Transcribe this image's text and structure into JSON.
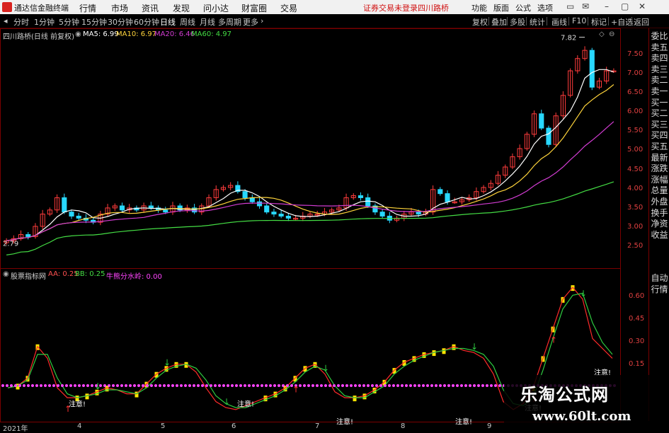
{
  "app": {
    "title": "通达信金融终端"
  },
  "menu": [
    "行情",
    "市场",
    "资讯",
    "发现",
    "问小达",
    "财富圈",
    "交易"
  ],
  "notice": "证券交易未登录",
  "stock_name_top": "四川路桥",
  "top_right": [
    "功能",
    "版面",
    "公式",
    "选项"
  ],
  "toolbar": {
    "periods": [
      "分时",
      "1分钟",
      "5分钟",
      "15分钟",
      "30分钟",
      "60分钟",
      "日线",
      "周线",
      "月线",
      "多周期",
      "更多"
    ],
    "active_period": "日线",
    "right": [
      "复权",
      "叠加",
      "多股",
      "统计",
      "画线",
      "F10",
      "标记",
      "+自选",
      "返回"
    ]
  },
  "main_info": {
    "title": "四川路桥(日线 前复权)",
    "ma5": "MA5: 6.99",
    "ma10": "MA10: 6.97",
    "ma20": "MA20: 6.46",
    "ma60": "MA60: 4.97",
    "high_label": "7.82",
    "low_label": "2.79"
  },
  "sub_info": {
    "title": "股票指标网",
    "aa": "AA: 0.25",
    "bb": "BB: 0.25",
    "cc": "牛熊分水岭: 0.00"
  },
  "main_axis": [
    "7.50",
    "7.00",
    "6.50",
    "6.00",
    "5.50",
    "5.00",
    "4.50",
    "4.00",
    "3.50",
    "3.00",
    "2.50"
  ],
  "sub_axis": [
    "0.60",
    "0.45",
    "0.30",
    "0.15"
  ],
  "x_axis": [
    "2021年",
    "4",
    "5",
    "6",
    "7",
    "8",
    "9"
  ],
  "side_tabs": [
    "委比",
    "卖五",
    "卖四",
    "卖三",
    "卖二",
    "卖一",
    "买一",
    "买二",
    "买三",
    "买四",
    "买五",
    "最新",
    "涨跌",
    "涨幅",
    "总量",
    "外盘",
    "换手",
    "净资",
    "收益"
  ],
  "side_bottom": [
    "自动",
    "行情"
  ],
  "annotations": [
    "注意!",
    "注意!",
    "注意!",
    "注意!",
    "注意!",
    "注意!"
  ],
  "watermark": {
    "text": "乐淘公式网",
    "url": "www.60lt.com"
  },
  "colors": {
    "up": "#ff3c3c",
    "down": "#28d8ff",
    "ma5": "#ffffff",
    "ma10": "#ffd43b",
    "ma20": "#d23cd2",
    "ma60": "#44dd44",
    "border": "#7a0000",
    "divider": "#ff44ff"
  },
  "chart_data": [
    {
      "type": "candlestick",
      "title": "四川路桥(日线 前复权)",
      "ylim": [
        2.3,
        7.9
      ],
      "x_ticks": [
        "2021年",
        "4",
        "5",
        "6",
        "7",
        "8",
        "9"
      ],
      "close": [
        2.85,
        2.9,
        3.0,
        2.95,
        3.2,
        3.5,
        3.6,
        3.9,
        3.55,
        3.45,
        3.4,
        3.35,
        3.3,
        3.5,
        3.65,
        3.7,
        3.6,
        3.65,
        3.6,
        3.7,
        3.65,
        3.6,
        3.55,
        3.7,
        3.6,
        3.65,
        3.55,
        3.7,
        3.9,
        4.1,
        4.15,
        4.2,
        4.05,
        3.9,
        3.8,
        3.7,
        3.55,
        3.5,
        3.45,
        3.4,
        3.4,
        3.45,
        3.5,
        3.5,
        3.55,
        3.6,
        3.65,
        3.9,
        3.95,
        3.9,
        3.7,
        3.55,
        3.45,
        3.35,
        3.4,
        3.5,
        3.55,
        3.5,
        3.55,
        4.1,
        4.0,
        3.8,
        3.8,
        3.85,
        3.9,
        4.05,
        4.15,
        4.25,
        4.45,
        4.65,
        4.9,
        5.1,
        5.45,
        5.95,
        5.6,
        5.2,
        5.9,
        6.4,
        7.0,
        7.3,
        7.5,
        6.6,
        6.75,
        7.0,
        7.0
      ],
      "ma5": "6.99",
      "ma10": "6.97",
      "ma20": "6.46",
      "ma60": "4.97"
    },
    {
      "type": "line",
      "title": "股票指标网",
      "ylim": [
        0,
        0.7
      ],
      "series": [
        {
          "name": "AA",
          "values": [
            0.15,
            0.16,
            0.2,
            0.36,
            0.3,
            0.15,
            0.1,
            0.1,
            0.11,
            0.13,
            0.15,
            0.14,
            0.12,
            0.12,
            0.17,
            0.22,
            0.25,
            0.27,
            0.27,
            0.23,
            0.15,
            0.08,
            0.05,
            0.04,
            0.06,
            0.08,
            0.1,
            0.12,
            0.15,
            0.2,
            0.25,
            0.27,
            0.22,
            0.13,
            0.1,
            0.1,
            0.11,
            0.14,
            0.18,
            0.24,
            0.28,
            0.3,
            0.32,
            0.33,
            0.34,
            0.36,
            0.34,
            0.33,
            0.3,
            0.22,
            0.08,
            0.04,
            0.07,
            0.15,
            0.3,
            0.45,
            0.6,
            0.66,
            0.6,
            0.4,
            0.35,
            0.3
          ]
        },
        {
          "name": "BB",
          "values": [
            0.15,
            0.16,
            0.19,
            0.32,
            0.32,
            0.2,
            0.12,
            0.1,
            0.11,
            0.12,
            0.14,
            0.14,
            0.13,
            0.12,
            0.15,
            0.2,
            0.24,
            0.26,
            0.27,
            0.25,
            0.19,
            0.11,
            0.07,
            0.05,
            0.05,
            0.07,
            0.09,
            0.11,
            0.14,
            0.18,
            0.23,
            0.26,
            0.24,
            0.16,
            0.11,
            0.1,
            0.1,
            0.13,
            0.16,
            0.22,
            0.26,
            0.29,
            0.31,
            0.33,
            0.34,
            0.35,
            0.35,
            0.34,
            0.32,
            0.26,
            0.14,
            0.07,
            0.06,
            0.1,
            0.24,
            0.4,
            0.55,
            0.62,
            0.63,
            0.48,
            0.38,
            0.32
          ]
        },
        {
          "name": "牛熊分水岭",
          "values": [
            0,
            0,
            0,
            0,
            0,
            0,
            0,
            0,
            0,
            0,
            0,
            0,
            0,
            0,
            0,
            0,
            0,
            0,
            0,
            0,
            0,
            0,
            0,
            0,
            0,
            0,
            0,
            0,
            0,
            0,
            0,
            0,
            0,
            0,
            0,
            0,
            0,
            0,
            0,
            0,
            0,
            0,
            0,
            0,
            0,
            0,
            0,
            0,
            0,
            0,
            0,
            0,
            0,
            0,
            0,
            0,
            0,
            0,
            0,
            0,
            0,
            0
          ]
        }
      ]
    }
  ]
}
